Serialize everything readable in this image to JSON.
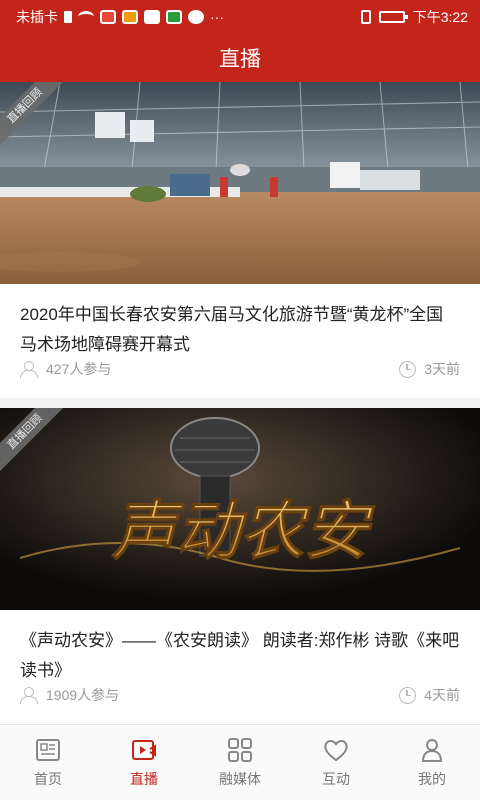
{
  "status_bar": {
    "carrier": "未插卡",
    "time": "下午3:22",
    "dots": "···"
  },
  "header": {
    "title": "直播"
  },
  "cards": [
    {
      "badge": "直播回顾",
      "title": "2020年中国长春农安第六届马文化旅游节暨“黄龙杯”全国马术场地障碍赛开幕式",
      "participants": "427人参与",
      "time_ago": "3天前"
    },
    {
      "badge": "直播回顾",
      "title": "《声动农安》——《农安朗读》 朗读者:郑作彬 诗歌《来吧  读书》",
      "participants": "1909人参与",
      "time_ago": "4天前",
      "image_text": "声动农安"
    }
  ],
  "bottom_nav": {
    "items": [
      {
        "label": "首页",
        "icon": "home-news-icon",
        "active": false
      },
      {
        "label": "直播",
        "icon": "live-video-icon",
        "active": true
      },
      {
        "label": "融媒体",
        "icon": "media-grid-icon",
        "active": false
      },
      {
        "label": "互动",
        "icon": "heart-icon",
        "active": false
      },
      {
        "label": "我的",
        "icon": "person-icon",
        "active": false
      }
    ]
  },
  "colors": {
    "brand": "#c3251a",
    "gold": "#d9a441"
  }
}
